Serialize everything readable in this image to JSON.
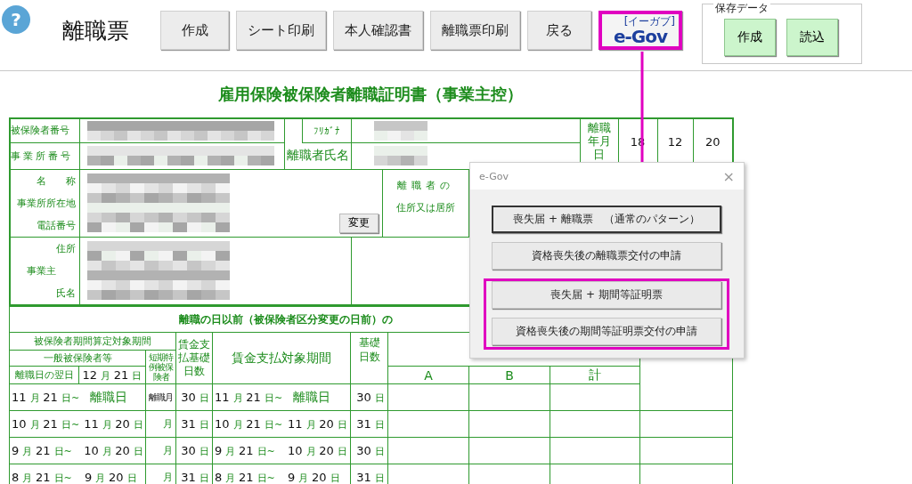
{
  "toolbar": {
    "help": "?",
    "title": "離職票",
    "buttons": [
      {
        "kind": "text",
        "label": "作成",
        "highlighted": false
      },
      {
        "kind": "text",
        "label": "シート印刷",
        "highlighted": false
      },
      {
        "kind": "text",
        "label": "本人確認書",
        "highlighted": false
      },
      {
        "kind": "text",
        "label": "離職票印刷",
        "highlighted": false
      },
      {
        "kind": "text",
        "label": "戻る",
        "highlighted": false
      },
      {
        "kind": "logo",
        "label": "e-Gov",
        "ruby": "[イーガブ]",
        "highlighted": true
      }
    ],
    "saved_data": {
      "legend": "保存データ",
      "buttons": [
        "作成",
        "読込"
      ]
    }
  },
  "form": {
    "title": "雇用保険被保険者離職証明書（事業主控）",
    "top": {
      "insured_number_label": "被保険者番号",
      "office_number_label": "事業所番号",
      "furigana_label": "ﾌﾘｶﾞﾅ",
      "name_label": "離職者氏名",
      "separation_date_label": "離職年月日",
      "separation_date": [
        "18",
        "12",
        "20"
      ],
      "office_labels": [
        "名　　称",
        "事業所所在地",
        "電話番号"
      ],
      "change_button": "変更",
      "address_label": [
        "離職者の",
        "住所又は居所"
      ],
      "employer_labels": [
        "住所",
        "事業主",
        "氏名"
      ]
    },
    "wages": {
      "title": "離職の日以前（被保険者区分変更の日前）の",
      "period_header": "被保険者期間算定対象期間",
      "general_header": "一般被保険者等",
      "short_term_header": "短期特例被保険者",
      "basis_days_header": "賃金支払基礎日数",
      "wage_period_header": "賃金支払対象期間",
      "days_header": "基礎日数",
      "next_day_label": "離職日の翌日",
      "next_day": "12 月 21 日",
      "columns": [
        "A",
        "B",
        "計"
      ],
      "rows": [
        {
          "start": "11 月 21 日~",
          "end": {
            "kind": "label",
            "text": "離職日"
          },
          "short_term": {
            "kind": "label",
            "text": "離職月"
          },
          "days": "30 日",
          "wage_start": "11 月 21 日~",
          "wage_end": {
            "kind": "label",
            "text": "離職日"
          },
          "wage_days": "30 日"
        },
        {
          "start": "10 月 21 日~",
          "end": {
            "kind": "date",
            "text": "11 月 20 日"
          },
          "short_term": {
            "kind": "unit",
            "text": "月"
          },
          "days": "31 日",
          "wage_start": "10 月 21 日~",
          "wage_end": {
            "kind": "date",
            "text": "11 月 20 日"
          },
          "wage_days": "31 日"
        },
        {
          "start": "9 月 21 日~",
          "end": {
            "kind": "date",
            "text": "10 月 20 日"
          },
          "short_term": {
            "kind": "unit",
            "text": "月"
          },
          "days": "30 日",
          "wage_start": "9 月 21 日~",
          "wage_end": {
            "kind": "date",
            "text": "10 月 20 日"
          },
          "wage_days": "30 日"
        },
        {
          "start": "8 月 21 日~",
          "end": {
            "kind": "date",
            "text": "9 月 20 日"
          },
          "short_term": {
            "kind": "unit",
            "text": "月"
          },
          "days": "31 日",
          "wage_start": "8 月 21 日~",
          "wage_end": {
            "kind": "date",
            "text": "9 月 20 日"
          },
          "wage_days": "31 日"
        }
      ]
    }
  },
  "dialog": {
    "title": "e-Gov",
    "close": "×",
    "groups": [
      {
        "highlighted": false,
        "buttons": [
          {
            "label": "喪失届 + 離職票　（通常のパターン）",
            "default": true
          },
          {
            "label": "資格喪失後の離職票交付の申請",
            "default": false
          }
        ]
      },
      {
        "highlighted": true,
        "buttons": [
          {
            "label": "喪失届 + 期間等証明票",
            "default": false
          },
          {
            "label": "資格喪失後の期間等証明票交付の申請",
            "default": false
          }
        ]
      }
    ]
  }
}
